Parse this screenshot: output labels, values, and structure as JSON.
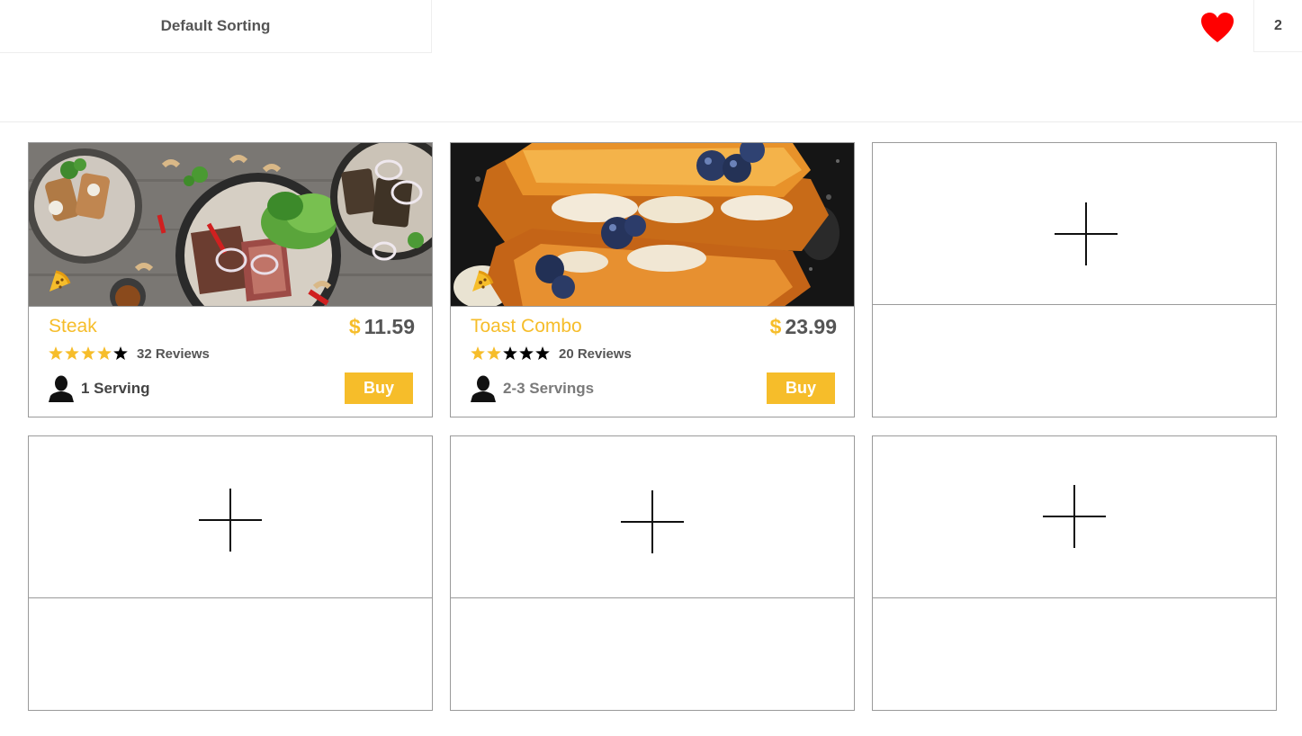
{
  "header": {
    "sort_label": "Default Sorting",
    "favorites_count": "2",
    "heart_color": "#ff0000"
  },
  "accent_color": "#f6bd2a",
  "products": [
    {
      "title": "Steak",
      "currency": "$",
      "price": "11.59",
      "rating": 4,
      "rating_max": 5,
      "reviews": "32 Reviews",
      "servings": "1 Serving",
      "buy_label": "Buy",
      "badge_icon": "pizza-slice-icon"
    },
    {
      "title": "Toast Combo",
      "currency": "$",
      "price": "23.99",
      "rating": 2,
      "rating_max": 5,
      "reviews": "20 Reviews",
      "servings": "2-3 Servings",
      "buy_label": "Buy",
      "badge_icon": "pizza-slice-icon"
    }
  ],
  "empty_slots": [
    {
      "icon": "plus-icon"
    },
    {
      "icon": "plus-icon"
    },
    {
      "icon": "plus-icon"
    },
    {
      "icon": "plus-icon"
    }
  ]
}
